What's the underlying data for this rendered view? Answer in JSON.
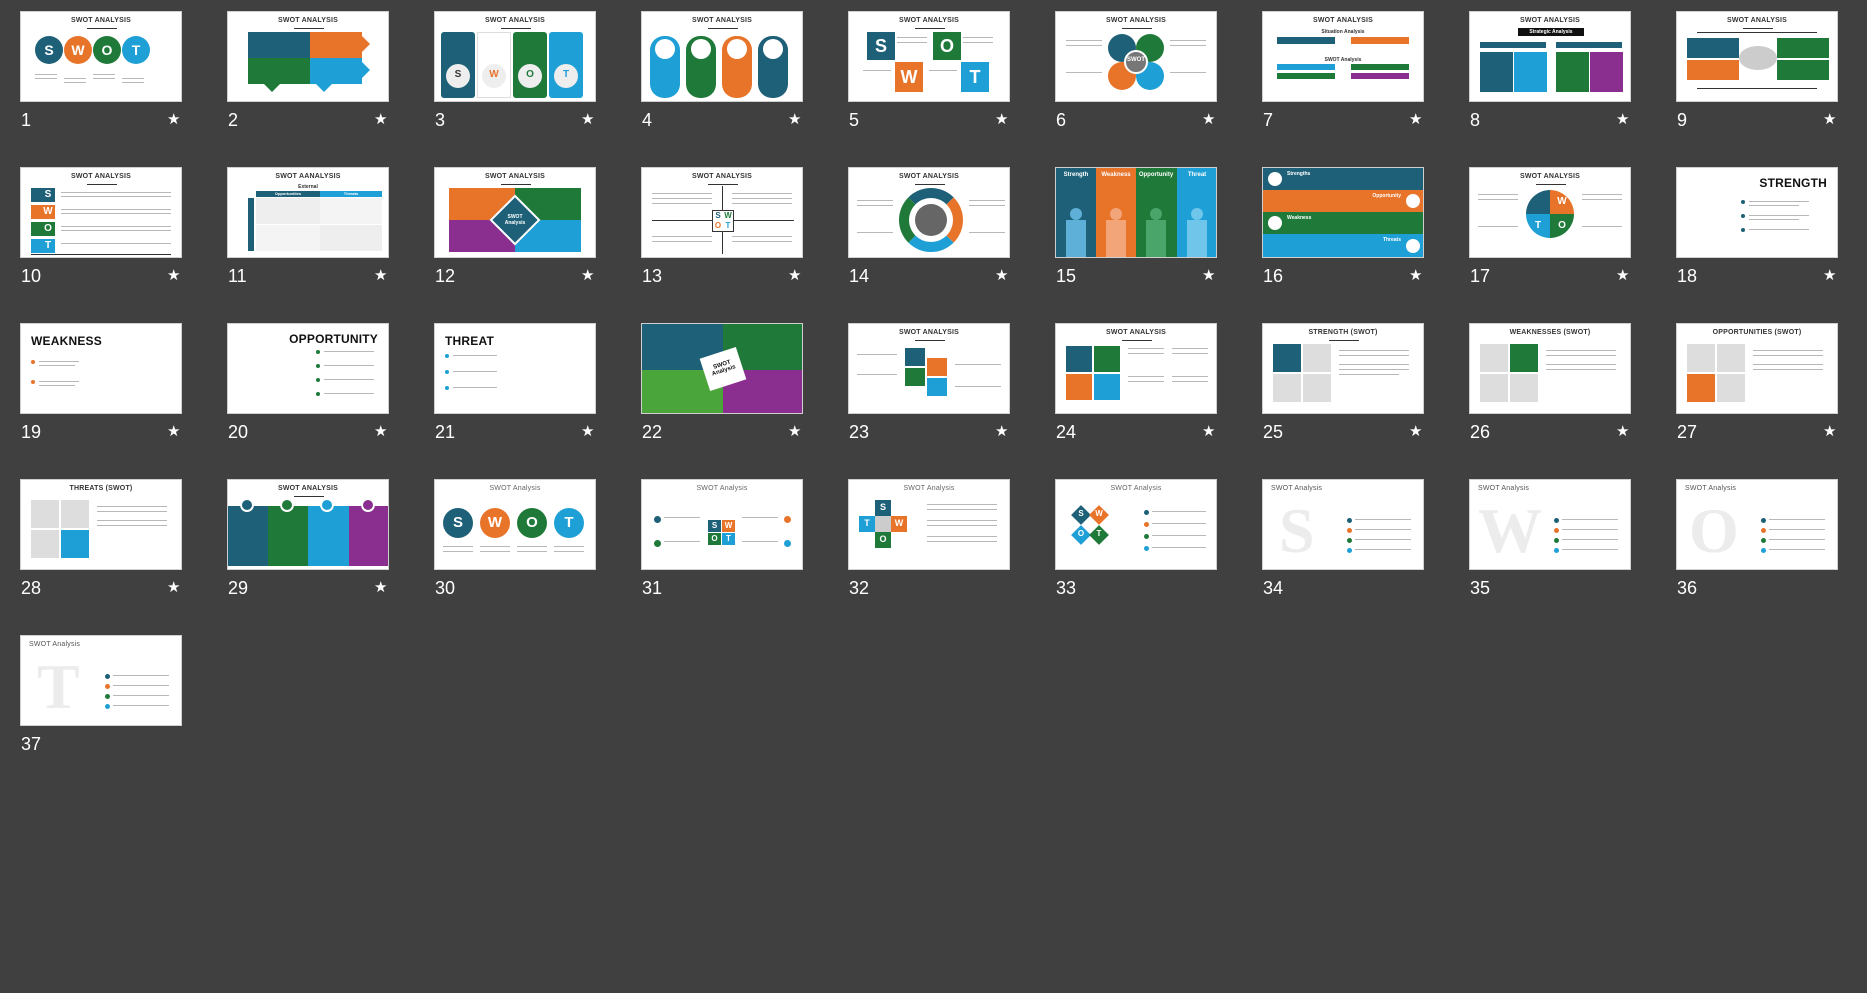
{
  "colors": {
    "teal": "#1d6078",
    "orange": "#e8742a",
    "green": "#1f7a3a",
    "blue": "#1ea0d7",
    "purple": "#8a2f8f",
    "background": "#404040"
  },
  "star_icon": "★",
  "slides": [
    {
      "number": "1",
      "title": "SWOT ANALYSIS",
      "labels": [
        "S",
        "W",
        "O",
        "T"
      ]
    },
    {
      "number": "2",
      "title": "SWOT ANALYSIS"
    },
    {
      "number": "3",
      "title": "SWOT ANALYSIS",
      "labels": [
        "S",
        "W",
        "O",
        "T"
      ]
    },
    {
      "number": "4",
      "title": "SWOT ANALYSIS"
    },
    {
      "number": "5",
      "title": "SWOT ANALYSIS",
      "labels": [
        "S",
        "O",
        "W",
        "T"
      ]
    },
    {
      "number": "6",
      "title": "SWOT ANALYSIS",
      "center": "SWOT"
    },
    {
      "number": "7",
      "title": "SWOT ANALYSIS",
      "sub1": "Situation Analysis",
      "sub2": "SWOT Analysis"
    },
    {
      "number": "8",
      "title": "SWOT ANALYSIS",
      "sub1": "Strategic Analysis"
    },
    {
      "number": "9",
      "title": "SWOT ANALYSIS"
    },
    {
      "number": "10",
      "title": "SWOT ANALYSIS",
      "labels": [
        "S",
        "W",
        "O",
        "T"
      ]
    },
    {
      "number": "11",
      "title": "SWOT AANALYSIS",
      "sub1": "External",
      "sub2": "Opportunities",
      "sub3": "Threats"
    },
    {
      "number": "12",
      "title": "SWOT ANALYSIS",
      "center": "SWOT Analysis"
    },
    {
      "number": "13",
      "title": "SWOT ANALYSIS",
      "labels": [
        "S",
        "W",
        "O",
        "T"
      ]
    },
    {
      "number": "14",
      "title": "SWOT ANALYSIS"
    },
    {
      "number": "15",
      "labels": [
        "Strength",
        "Weakness",
        "Opportunity",
        "Threat"
      ]
    },
    {
      "number": "16",
      "labels": [
        "Strengths",
        "Opportunity",
        "Weakness",
        "Threats"
      ]
    },
    {
      "number": "17",
      "title": "SWOT ANALYSIS",
      "labels": [
        "S",
        "W",
        "O",
        "T"
      ]
    },
    {
      "number": "18",
      "title": "STRENGTH"
    },
    {
      "number": "19",
      "title": "WEAKNESS"
    },
    {
      "number": "20",
      "title": "OPPORTUNITY"
    },
    {
      "number": "21",
      "title": "THREAT"
    },
    {
      "number": "22",
      "center": "SWOT Analysis"
    },
    {
      "number": "23",
      "title": "SWOT ANALYSIS"
    },
    {
      "number": "24",
      "title": "SWOT ANALYSIS"
    },
    {
      "number": "25",
      "title": "STRENGTH (SWOT)"
    },
    {
      "number": "26",
      "title": "WEAKNESSES (SWOT)"
    },
    {
      "number": "27",
      "title": "OPPORTUNITIES (SWOT)"
    },
    {
      "number": "28",
      "title": "THREATS (SWOT)"
    },
    {
      "number": "29",
      "title": "SWOT ANALYSIS"
    },
    {
      "number": "30",
      "title": "SWOT Analysis",
      "labels": [
        "S",
        "W",
        "O",
        "T"
      ]
    },
    {
      "number": "31",
      "title": "SWOT Analysis",
      "labels": [
        "S",
        "W",
        "O",
        "T"
      ]
    },
    {
      "number": "32",
      "title": "SWOT Analysis",
      "labels": [
        "S",
        "W",
        "O",
        "T"
      ]
    },
    {
      "number": "33",
      "title": "SWOT Analysis",
      "labels": [
        "S",
        "W",
        "O",
        "T"
      ]
    },
    {
      "number": "34",
      "title": "SWOT Analysis",
      "letter": "S"
    },
    {
      "number": "35",
      "title": "SWOT Analysis",
      "letter": "W"
    },
    {
      "number": "36",
      "title": "SWOT Analysis",
      "letter": "O"
    },
    {
      "number": "37",
      "title": "SWOT Analysis",
      "letter": "T"
    }
  ]
}
